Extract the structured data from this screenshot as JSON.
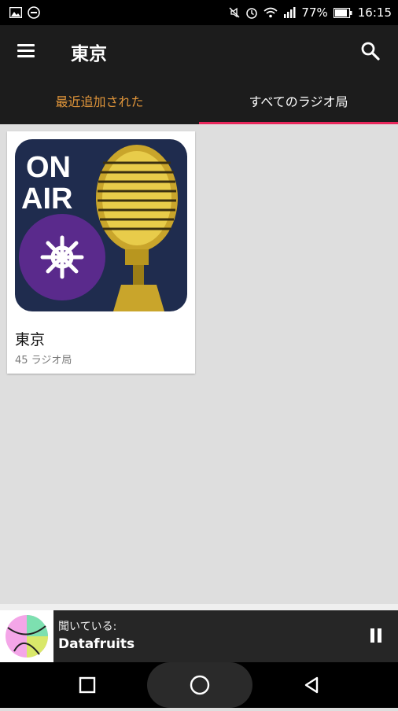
{
  "status_bar": {
    "battery": "77%",
    "time": "16:15"
  },
  "app_bar": {
    "title": "東京",
    "menu_icon": "hamburger-menu-icon",
    "search_icon": "search-icon"
  },
  "tabs": [
    {
      "label": "最近追加された",
      "color": "#e0953a"
    },
    {
      "label": "すべてのラジオ局",
      "selected": true,
      "indicator_color": "#e8285c"
    }
  ],
  "cards": [
    {
      "art_text_line1": "ON",
      "art_text_line2": "AIR",
      "title": "東京",
      "subtitle": "45 ラジオ局"
    }
  ],
  "player": {
    "now_playing_label": "聞いている:",
    "station": "Datafruits",
    "pause_icon": "pause-icon"
  },
  "nav": {
    "recents_icon": "square-icon",
    "home_icon": "circle-icon",
    "back_icon": "triangle-back-icon"
  }
}
